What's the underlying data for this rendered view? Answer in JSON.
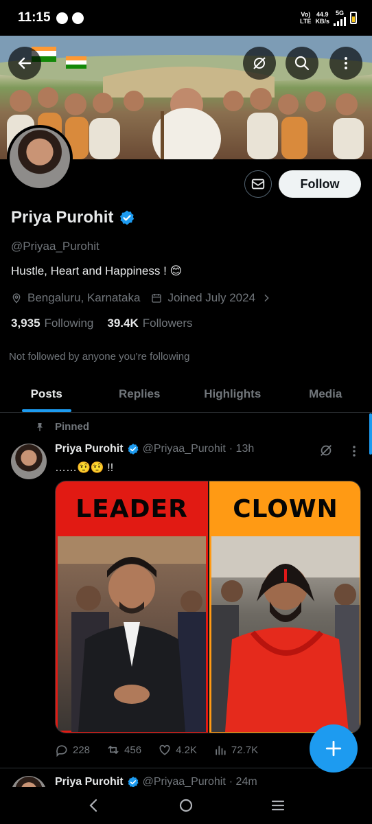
{
  "status_bar": {
    "time": "11:15",
    "network_line1": "Vo)",
    "network_line2": "LTE",
    "speed_value": "44.9",
    "speed_unit": "KB/s",
    "network_type": "5G"
  },
  "profile": {
    "name": "Priya Purohit",
    "handle": "@Priyaa_Purohit",
    "bio": "Hustle, Heart and Happiness ! 😊",
    "location": "Bengaluru, Karnataka",
    "joined": "Joined July 2024",
    "following_count": "3,935",
    "following_label": "Following",
    "followers_count": "39.4K",
    "followers_label": "Followers",
    "not_followed_text": "Not followed by anyone you’re following",
    "follow_button": "Follow"
  },
  "tabs": [
    {
      "label": "Posts",
      "active": true
    },
    {
      "label": "Replies",
      "active": false
    },
    {
      "label": "Highlights",
      "active": false
    },
    {
      "label": "Media",
      "active": false
    }
  ],
  "pinned_post": {
    "pinned_label": "Pinned",
    "author_name": "Priya Purohit",
    "author_handle": "@Priyaa_Purohit",
    "time": "· 13h",
    "text": "……🤨🤨 !!",
    "media_left_caption": "LEADER",
    "media_right_caption": "CLOWN",
    "stats": {
      "replies": "228",
      "reposts": "456",
      "likes": "4.2K",
      "views": "72.7K"
    }
  },
  "next_post": {
    "author_name": "Priya Purohit",
    "author_handle": "@Priyaa_Purohit",
    "time": "· 24m"
  },
  "colors": {
    "accent": "#1d9bf0",
    "background": "#000000",
    "muted": "#71767b",
    "leader_panel": "#e11a13",
    "clown_panel": "#ff9a14"
  },
  "icons": [
    "back-arrow-icon",
    "grok-icon",
    "search-icon",
    "more-icon",
    "mail-icon",
    "verified-icon",
    "location-icon",
    "calendar-icon",
    "chevron-right-icon",
    "pin-icon",
    "reply-icon",
    "repost-icon",
    "like-icon",
    "views-icon",
    "plus-icon",
    "nav-back-icon",
    "nav-home-icon",
    "nav-menu-icon"
  ]
}
